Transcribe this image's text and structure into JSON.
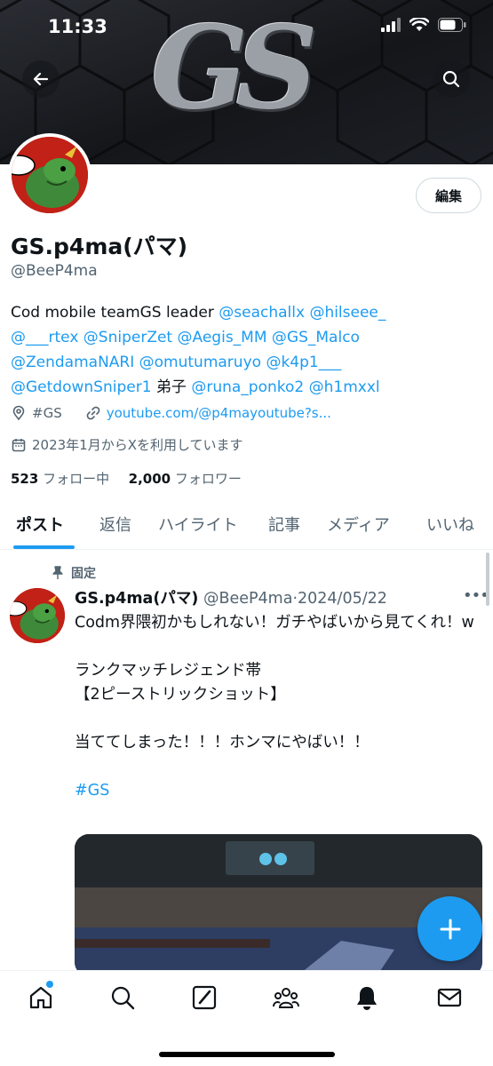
{
  "status_bar": {
    "time": "11:33"
  },
  "banner": {
    "logo_text": "GS"
  },
  "profile": {
    "display_name": "GS.p4ma(パマ)",
    "handle": "@BeeP4ma",
    "edit_label": "編集",
    "bio": {
      "line1_text": "Cod mobile teamGS leader ",
      "line1_mentions": [
        "@seachallx",
        "@hilseee_"
      ],
      "line2_mentions": [
        "@___rtex",
        "@SniperZet",
        "@Aegis_MM",
        "@GS_Malco"
      ],
      "line3_mentions": [
        "@ZendamaNARI",
        "@omutumaruyo",
        "@k4p1___"
      ],
      "line4_mention1": "@GetdownSniper1",
      "line4_text": " 弟子 ",
      "line4_mentions": [
        "@runa_ponko2",
        "@h1mxxl"
      ]
    },
    "location": "#GS",
    "website": "youtube.com/@p4mayoutube?s...",
    "joined": "2023年1月からXを利用しています",
    "following_count": "523",
    "following_label": "フォロー中",
    "followers_count": "2,000",
    "followers_label": "フォロワー"
  },
  "tabs": [
    "ポスト",
    "返信",
    "ハイライト",
    "記事",
    "メディア",
    "いいね"
  ],
  "post": {
    "pinned_label": "固定",
    "author_name": "GS.p4ma(パマ)",
    "author_handle": "@BeeP4ma",
    "date": "2024/05/22",
    "lines": [
      "Codm界隈初かもしれない！ガチやばいから見てくれ！w",
      "",
      "ランクマッチレジェンド帯",
      "【2ピーストリックショット】",
      "",
      "当ててしまった！！！ホンマにやばい！！",
      ""
    ],
    "hashtag": "#GS"
  },
  "colors": {
    "accent": "#1d9bf0",
    "text": "#0f1419",
    "secondary": "#536471"
  },
  "bottom_nav": [
    "home-icon",
    "search-icon",
    "grok-icon",
    "communities-icon",
    "notifications-icon",
    "messages-icon"
  ]
}
